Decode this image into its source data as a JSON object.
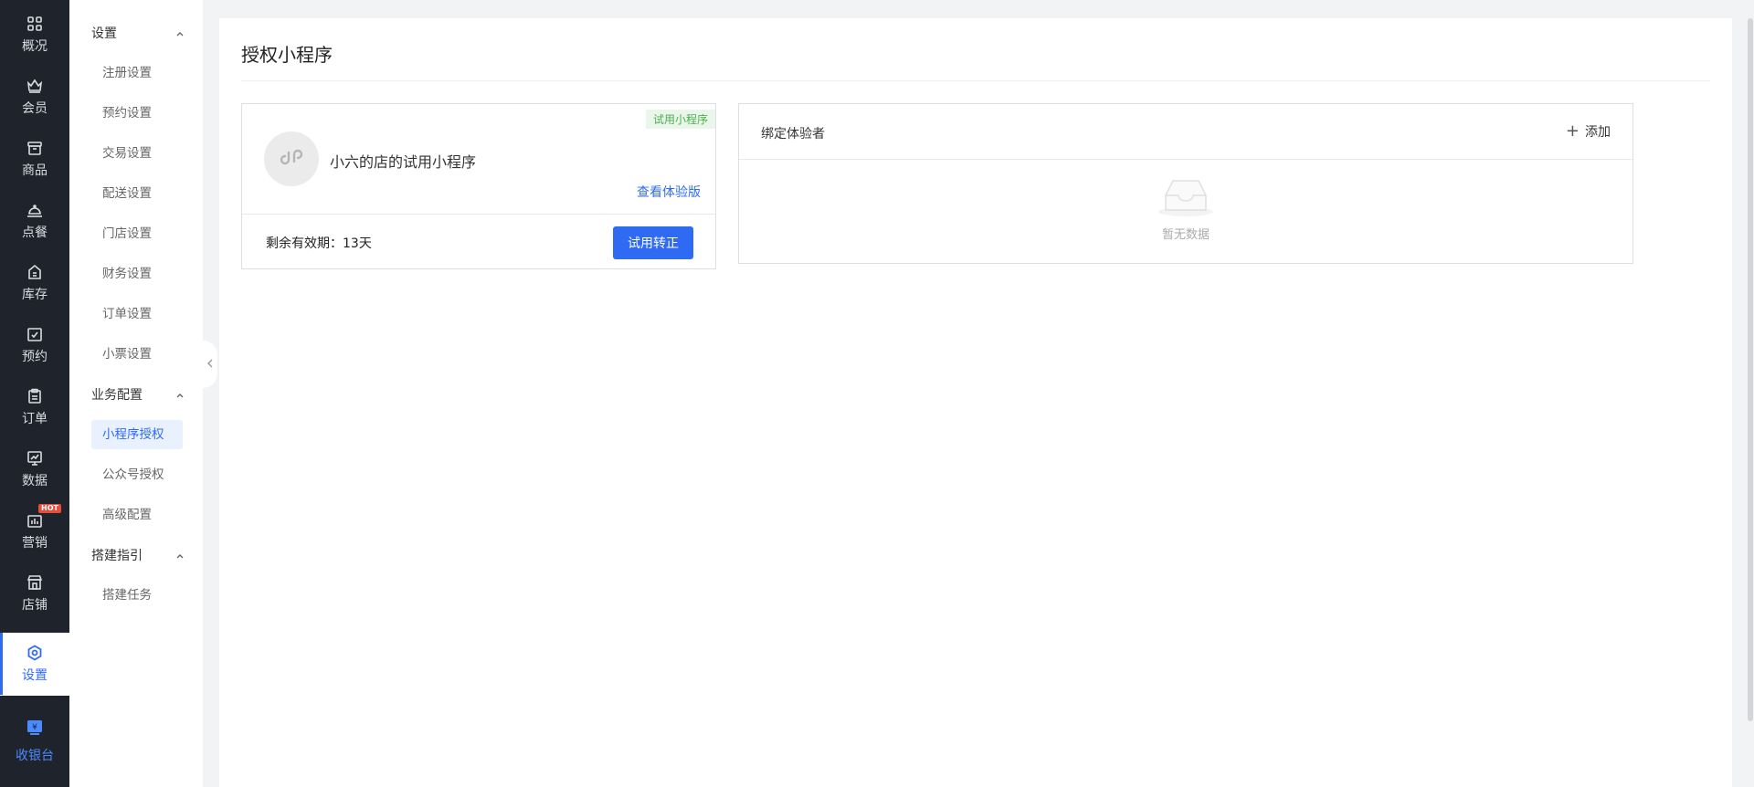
{
  "rail": {
    "items": [
      {
        "label": "概况",
        "icon": "grid-icon"
      },
      {
        "label": "会员",
        "icon": "crown-icon"
      },
      {
        "label": "商品",
        "icon": "box-icon"
      },
      {
        "label": "点餐",
        "icon": "cloche-icon"
      },
      {
        "label": "库存",
        "icon": "inventory-icon"
      },
      {
        "label": "预约",
        "icon": "calendar-check-icon"
      },
      {
        "label": "订单",
        "icon": "clipboard-icon"
      },
      {
        "label": "数据",
        "icon": "chart-icon"
      },
      {
        "label": "营销",
        "icon": "marketing-icon",
        "badge": "HOT"
      },
      {
        "label": "店铺",
        "icon": "store-icon"
      },
      {
        "label": "设置",
        "icon": "gear-icon",
        "active": true
      }
    ],
    "bottom": {
      "label": "收银台",
      "icon": "cashier-icon"
    }
  },
  "subnav": {
    "groups": [
      {
        "title": "设置",
        "items": [
          "注册设置",
          "预约设置",
          "交易设置",
          "配送设置",
          "门店设置",
          "财务设置",
          "订单设置",
          "小票设置"
        ]
      },
      {
        "title": "业务配置",
        "items": [
          "小程序授权",
          "公众号授权",
          "高级配置"
        ],
        "active_item": "小程序授权"
      },
      {
        "title": "搭建指引",
        "items": [
          "搭建任务"
        ]
      }
    ]
  },
  "main": {
    "title": "授权小程序",
    "app_card": {
      "tag": "试用小程序",
      "name": "小六的店的试用小程序",
      "view_link": "查看体验版",
      "expiry": "剩余有效期：13天",
      "convert_button": "试用转正"
    },
    "tester_card": {
      "title": "绑定体验者",
      "add_label": "添加",
      "empty_text": "暂无数据"
    }
  },
  "colors": {
    "accent": "#2f6bf2",
    "rail_bg": "#1f232b",
    "tag_green": "#4caf50"
  }
}
